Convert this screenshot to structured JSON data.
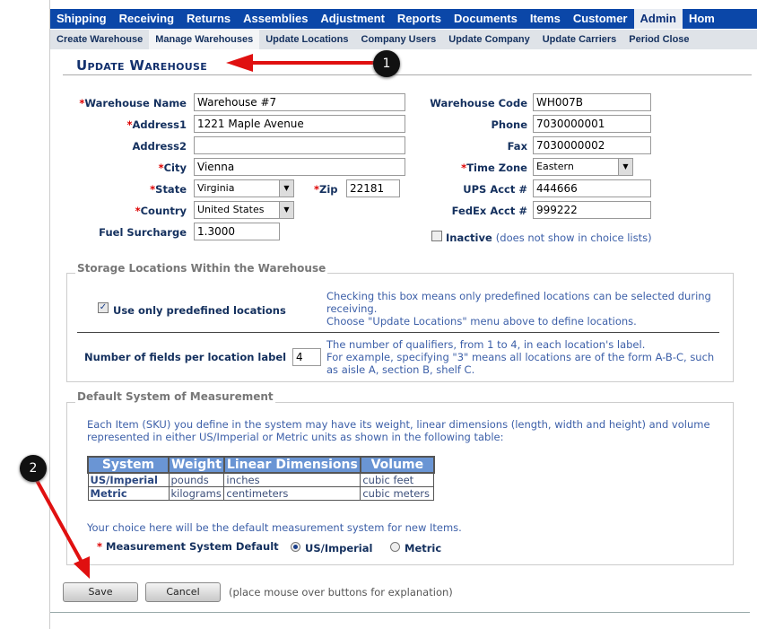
{
  "nav": {
    "tabs": [
      "Shipping",
      "Receiving",
      "Returns",
      "Assemblies",
      "Adjustment",
      "Reports",
      "Documents",
      "Items",
      "Customer",
      "Admin",
      "Hom"
    ],
    "active": "Admin"
  },
  "subnav": {
    "tabs": [
      "Create Warehouse",
      "Manage Warehouses",
      "Update Locations",
      "Company Users",
      "Update Company",
      "Update Carriers",
      "Period Close"
    ],
    "active": "Manage Warehouses"
  },
  "title": "Update Warehouse",
  "form": {
    "warehouse_name": {
      "label": "Warehouse Name",
      "value": "Warehouse #7"
    },
    "address1": {
      "label": "Address1",
      "value": "1221 Maple Avenue"
    },
    "address2": {
      "label": "Address2",
      "value": ""
    },
    "city": {
      "label": "City",
      "value": "Vienna"
    },
    "state": {
      "label": "State",
      "value": "Virginia"
    },
    "zip": {
      "label": "Zip",
      "value": "22181"
    },
    "country": {
      "label": "Country",
      "value": "United States"
    },
    "fuel": {
      "label": "Fuel Surcharge",
      "value": "1.3000"
    },
    "code": {
      "label": "Warehouse Code",
      "value": "WH007B"
    },
    "phone": {
      "label": "Phone",
      "value": "7030000001"
    },
    "fax": {
      "label": "Fax",
      "value": "7030000002"
    },
    "timezone": {
      "label": "Time Zone",
      "value": "Eastern"
    },
    "ups": {
      "label": "UPS Acct #",
      "value": "444666"
    },
    "fedex": {
      "label": "FedEx Acct #",
      "value": "999222"
    },
    "inactive": {
      "label": "Inactive",
      "note": "(does not show in choice lists)",
      "checked": false
    },
    "required_mark": "*"
  },
  "storage": {
    "legend": "Storage Locations Within the Warehouse",
    "predefined_label": "Use only predefined locations",
    "predefined_checked": true,
    "help1a": "Checking this box means only predefined locations can be selected during receiving.",
    "help1b": "Choose \"Update Locations\" menu above to define locations.",
    "fields_label": "Number of fields per location label",
    "fields_value": "4",
    "help2a": "The number of qualifiers, from 1 to 4, in each location's label.",
    "help2b": "For example, specifying \"3\" means all locations are of the form A-B-C, such as aisle A, section B, shelf C."
  },
  "measure": {
    "legend": "Default System of Measurement",
    "intro": "Each Item (SKU) you define in the system may have its weight, linear dimensions (length, width and height) and volume represented in either US/Imperial or Metric units as shown in the following table:",
    "headers": [
      "System",
      "Weight",
      "Linear Dimensions",
      "Volume"
    ],
    "rows": [
      [
        "US/Imperial",
        "pounds",
        "inches",
        "cubic feet"
      ],
      [
        "Metric",
        "kilograms",
        "centimeters",
        "cubic meters"
      ]
    ],
    "choice_note": "Your choice here will be the default measurement system for new Items.",
    "default_label": "Measurement System Default",
    "options": [
      "US/Imperial",
      "Metric"
    ],
    "selected": "US/Imperial"
  },
  "buttons": {
    "save": "Save",
    "cancel": "Cancel",
    "hint": "(place mouse over buttons for explanation)"
  },
  "annotations": [
    "1",
    "2"
  ],
  "colors": {
    "nav": "#0b47a8",
    "arrow": "#e01010",
    "label": "#14305e",
    "help": "#3c5fa8"
  }
}
